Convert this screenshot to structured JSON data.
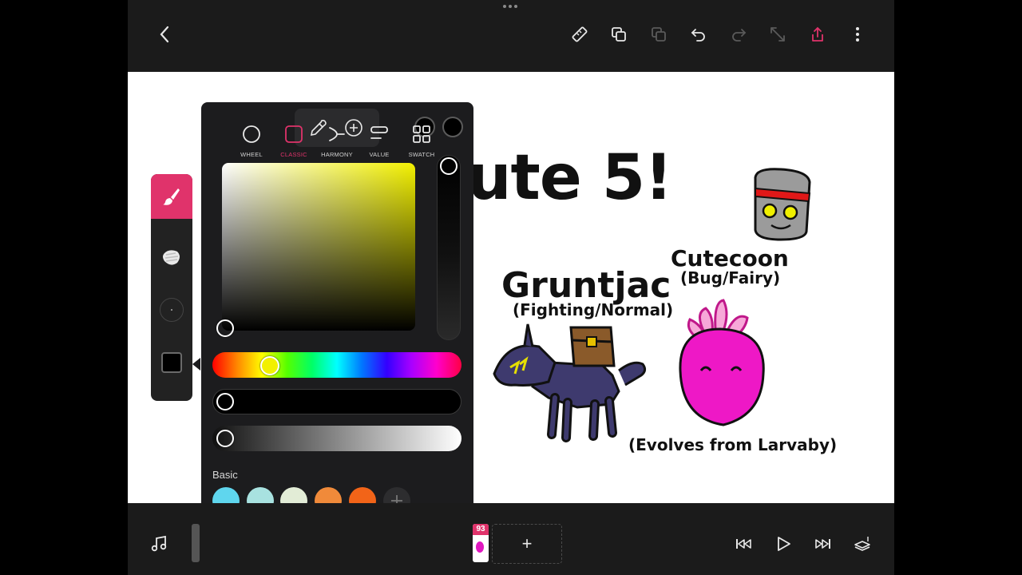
{
  "colors": {
    "accent": "#e0336b",
    "toolbar_bg": "#1b1b1b",
    "canvas_bg": "#ffffff",
    "picker_bg": "#1c1c1e"
  },
  "canvas": {
    "heading": "ute 5!",
    "creature1_name": "Gruntjac",
    "creature1_type": "(Fighting/Normal)",
    "creature2_name": "Cutecoon",
    "creature2_type": "(Bug/Fairy)",
    "creature3_note": "(Evolves from Larvaby)"
  },
  "toolbar": {
    "icons": [
      "back-icon",
      "ruler-icon",
      "duplicate-icon",
      "copy-icon",
      "undo-icon",
      "redo-icon",
      "transform-icon",
      "share-icon",
      "more-icon"
    ]
  },
  "color_picker": {
    "current_color": "#000000",
    "hue_color": "#f2f000",
    "hue_level": 0.2,
    "basic_label": "Basic",
    "basic_swatches": [
      "#5fd6ee",
      "#a8e2e0",
      "#e2ecd6",
      "#f08a3a",
      "#f26418"
    ],
    "tabs": [
      {
        "label": "WHEEL",
        "icon": "circle-icon"
      },
      {
        "label": "CLASSIC",
        "icon": "square-icon"
      },
      {
        "label": "HARMONY",
        "icon": "harmony-icon"
      },
      {
        "label": "VALUE",
        "icon": "sliders-icon"
      },
      {
        "label": "SWATCH",
        "icon": "grid-icon"
      }
    ],
    "active_tab": "CLASSIC"
  },
  "timeline": {
    "frame_number": "93",
    "add_frame": "+"
  }
}
